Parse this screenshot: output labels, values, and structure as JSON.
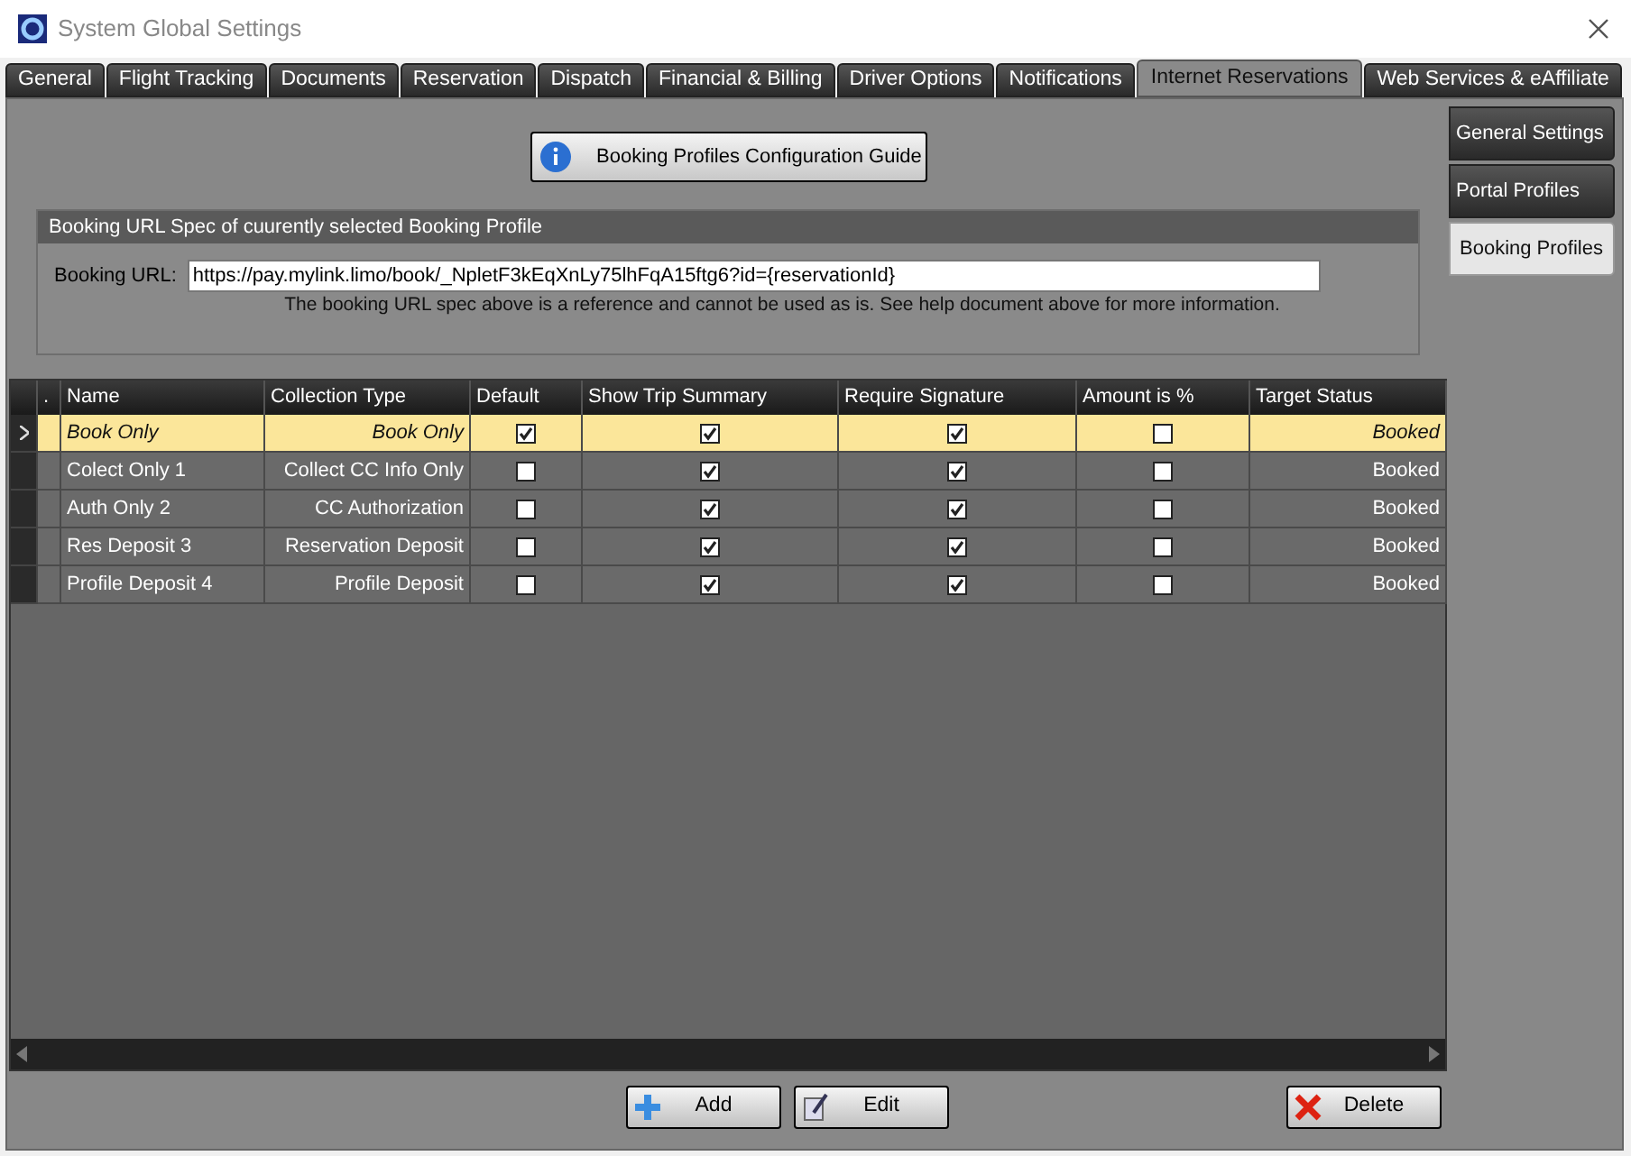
{
  "window": {
    "title": "System Global Settings"
  },
  "tabs": [
    {
      "label": "General",
      "selected": false
    },
    {
      "label": "Flight Tracking",
      "selected": false
    },
    {
      "label": "Documents",
      "selected": false
    },
    {
      "label": "Reservation",
      "selected": false
    },
    {
      "label": "Dispatch",
      "selected": false
    },
    {
      "label": "Financial & Billing",
      "selected": false
    },
    {
      "label": "Driver Options",
      "selected": false
    },
    {
      "label": "Notifications",
      "selected": false
    },
    {
      "label": "Internet Reservations",
      "selected": true
    },
    {
      "label": "Web Services & eAffiliate",
      "selected": false
    }
  ],
  "side_tabs": [
    {
      "label": "General Settings",
      "selected": false
    },
    {
      "label": "Portal Profiles",
      "selected": false
    },
    {
      "label": "Booking Profiles",
      "selected": true
    }
  ],
  "guide_button": "Booking Profiles Configuration Guide",
  "url_group": {
    "title": "Booking URL Spec of cuurently selected Booking Profile",
    "label": "Booking URL:",
    "value": "https://pay.mylink.limo/book/_NpletF3kEqXnLy75lhFqA15ftg6?id={reservationId}",
    "note": "The booking URL spec above is a reference and cannot be used as is. See help document above for more information."
  },
  "table": {
    "columns": [
      ".",
      "Name",
      "Collection Type",
      "Default",
      "Show Trip Summary",
      "Require Signature",
      "Amount is %",
      "Target Status"
    ],
    "rows": [
      {
        "selected": true,
        "name": "Book Only",
        "collection_type": "Book Only",
        "default": true,
        "show_trip_summary": true,
        "require_signature": true,
        "amount_is_percent": false,
        "target_status": "Booked"
      },
      {
        "selected": false,
        "name": "Colect Only 1",
        "collection_type": "Collect CC Info Only",
        "default": false,
        "show_trip_summary": true,
        "require_signature": true,
        "amount_is_percent": false,
        "target_status": "Booked"
      },
      {
        "selected": false,
        "name": "Auth Only 2",
        "collection_type": "CC Authorization",
        "default": false,
        "show_trip_summary": true,
        "require_signature": true,
        "amount_is_percent": false,
        "target_status": "Booked"
      },
      {
        "selected": false,
        "name": "Res Deposit 3",
        "collection_type": "Reservation Deposit",
        "default": false,
        "show_trip_summary": true,
        "require_signature": true,
        "amount_is_percent": false,
        "target_status": "Booked"
      },
      {
        "selected": false,
        "name": "Profile Deposit 4",
        "collection_type": "Profile Deposit",
        "default": false,
        "show_trip_summary": true,
        "require_signature": true,
        "amount_is_percent": false,
        "target_status": "Booked"
      }
    ]
  },
  "buttons": [
    {
      "kind": "add",
      "label": "Add"
    },
    {
      "kind": "edit",
      "label": "Edit"
    },
    {
      "kind": "delete",
      "label": "Delete"
    }
  ]
}
